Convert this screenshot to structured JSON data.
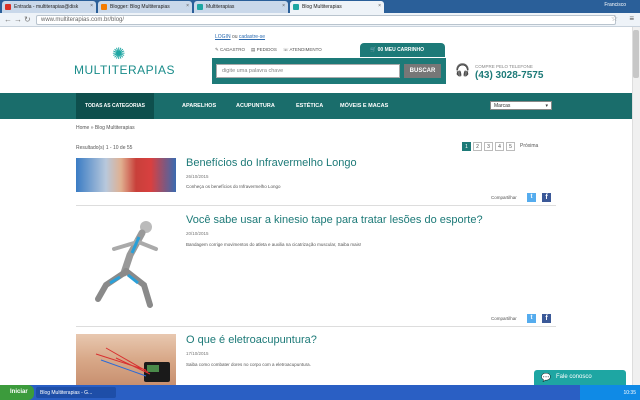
{
  "browser": {
    "tabs": [
      {
        "title": "Entrada - multiterapias@disk",
        "color": "#d93025"
      },
      {
        "title": "Blogger: Blog Multiterapias",
        "color": "#f57c00"
      },
      {
        "title": "Multiterapias",
        "color": "#1ea6a3"
      },
      {
        "title": "Blog Multiterapias",
        "color": "#1ea6a3"
      }
    ],
    "user": "Francisco",
    "url": "www.multiterapias.com.br/blog/"
  },
  "header": {
    "logo": "MULTITERAPIAS",
    "login_text": "LOGIN",
    "login_sep": " ou ",
    "signup_text": "cadastre-se",
    "links": [
      "CADASTRO",
      "PEDIDOS",
      "ATENDIMENTO"
    ],
    "cart": "00 MEU CARRINHO",
    "search_placeholder": "digite uma palavra chave",
    "search_button": "BUSCAR",
    "phone_label": "COMPRE PELO TELEFONE",
    "phone": "(43) 3028-7575"
  },
  "nav": {
    "all": "TODAS AS CATEGORIAS",
    "items": [
      "APARELHOS",
      "ACUPUNTURA",
      "ESTÉTICA",
      "MÓVEIS E MACAS"
    ],
    "brands": "Marcas"
  },
  "breadcrumb": "Home » Blog Multiterapias",
  "results": "Resultado(s) 1 - 10 de 55",
  "pagination": {
    "pages": [
      "1",
      "2",
      "3",
      "4",
      "5"
    ],
    "current": "1",
    "next": "Próxima"
  },
  "posts": [
    {
      "title": "Benefícios do Infravermelho Longo",
      "date": "26/10/2015",
      "desc": "Conheça os benefícios do Infravermelho Longo",
      "share": "Compartilhar"
    },
    {
      "title": "Você sabe usar a kinesio tape para tratar lesões do esporte?",
      "date": "20/10/2015",
      "desc": "Bandagem corrige movimentos do atleta e auxilia na cicatrização muscular, Saiba mais!",
      "share": "Compartilhar"
    },
    {
      "title": "O que é eletroacupuntura?",
      "date": "17/10/2015",
      "desc": "Saiba como combater dores no corpo com a eletroacupuntura.",
      "share": ""
    }
  ],
  "chat": "Fale conosco",
  "taskbar": {
    "start": "Iniciar",
    "item": "Blog Multiterapias - G...",
    "clock": "10:35"
  }
}
